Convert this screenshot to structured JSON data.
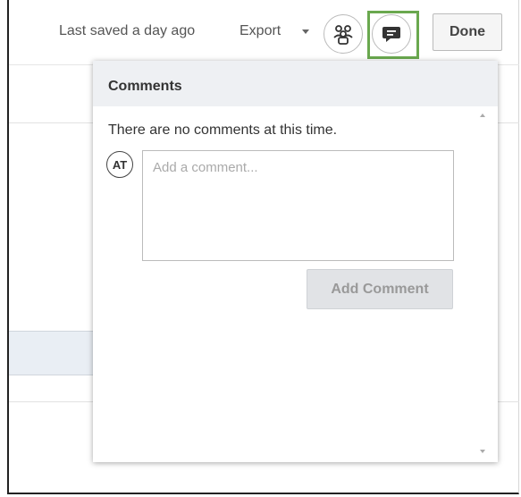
{
  "header": {
    "saved_status": "Last saved a day ago",
    "export_label": "Export",
    "done_label": "Done"
  },
  "comments_panel": {
    "title": "Comments",
    "empty_message": "There are no comments at this time.",
    "avatar_initials": "AT",
    "comment_placeholder": "Add a comment...",
    "add_comment_label": "Add Comment"
  },
  "colors": {
    "highlight": "#6aa84f",
    "panel_header": "#eef0f3"
  },
  "icons": {
    "collaborators": "people-group-icon",
    "comments": "comment-icon"
  }
}
